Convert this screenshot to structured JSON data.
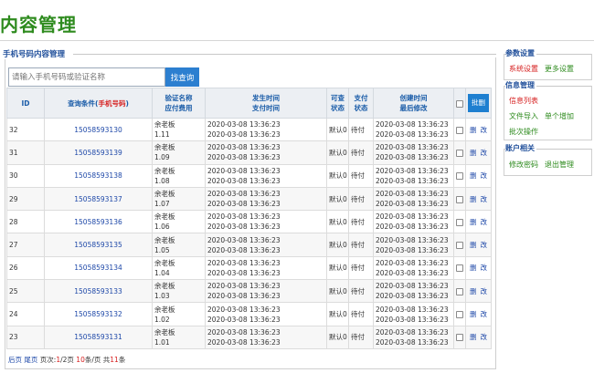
{
  "page_title": "内容管理",
  "panel_title": "手机号码内容管理",
  "search": {
    "placeholder": "请输入手机号码或验证名称",
    "button": "找查询"
  },
  "table": {
    "headers": {
      "id": "ID",
      "query_prefix": "查询条件(",
      "query_red": "手机号码",
      "query_suffix": ")",
      "name_line1": "验证名称",
      "name_line2": "应付费用",
      "time_line1": "发生时间",
      "time_line2": "支付时间",
      "status1_line1": "可查",
      "status1_line2": "状态",
      "status2_line1": "支付",
      "status2_line2": "状态",
      "created_line1": "创建时间",
      "created_line2": "最后修改",
      "batch_delete": "批删"
    },
    "rows": [
      {
        "id": "32",
        "phone": "15058593130",
        "name": "余老板",
        "fee": "1.11",
        "t1": "2020-03-08 13:36:23",
        "t2": "2020-03-08 13:36:23",
        "s1": "默认0",
        "s2": "待付",
        "c1": "2020-03-08 13:36:23",
        "c2": "2020-03-08 13:36:23",
        "del": "删",
        "edit": "改"
      },
      {
        "id": "31",
        "phone": "15058593139",
        "name": "余老板",
        "fee": "1.09",
        "t1": "2020-03-08 13:36:23",
        "t2": "2020-03-08 13:36:23",
        "s1": "默认0",
        "s2": "待付",
        "c1": "2020-03-08 13:36:23",
        "c2": "2020-03-08 13:36:23",
        "del": "删",
        "edit": "改"
      },
      {
        "id": "30",
        "phone": "15058593138",
        "name": "余老板",
        "fee": "1.08",
        "t1": "2020-03-08 13:36:23",
        "t2": "2020-03-08 13:36:23",
        "s1": "默认0",
        "s2": "待付",
        "c1": "2020-03-08 13:36:23",
        "c2": "2020-03-08 13:36:23",
        "del": "删",
        "edit": "改"
      },
      {
        "id": "29",
        "phone": "15058593137",
        "name": "余老板",
        "fee": "1.07",
        "t1": "2020-03-08 13:36:23",
        "t2": "2020-03-08 13:36:23",
        "s1": "默认0",
        "s2": "待付",
        "c1": "2020-03-08 13:36:23",
        "c2": "2020-03-08 13:36:23",
        "del": "删",
        "edit": "改"
      },
      {
        "id": "28",
        "phone": "15058593136",
        "name": "余老板",
        "fee": "1.06",
        "t1": "2020-03-08 13:36:23",
        "t2": "2020-03-08 13:36:23",
        "s1": "默认0",
        "s2": "待付",
        "c1": "2020-03-08 13:36:23",
        "c2": "2020-03-08 13:36:23",
        "del": "删",
        "edit": "改"
      },
      {
        "id": "27",
        "phone": "15058593135",
        "name": "余老板",
        "fee": "1.05",
        "t1": "2020-03-08 13:36:23",
        "t2": "2020-03-08 13:36:23",
        "s1": "默认0",
        "s2": "待付",
        "c1": "2020-03-08 13:36:23",
        "c2": "2020-03-08 13:36:23",
        "del": "删",
        "edit": "改"
      },
      {
        "id": "26",
        "phone": "15058593134",
        "name": "余老板",
        "fee": "1.04",
        "t1": "2020-03-08 13:36:23",
        "t2": "2020-03-08 13:36:23",
        "s1": "默认0",
        "s2": "待付",
        "c1": "2020-03-08 13:36:23",
        "c2": "2020-03-08 13:36:23",
        "del": "删",
        "edit": "改"
      },
      {
        "id": "25",
        "phone": "15058593133",
        "name": "余老板",
        "fee": "1.03",
        "t1": "2020-03-08 13:36:23",
        "t2": "2020-03-08 13:36:23",
        "s1": "默认0",
        "s2": "待付",
        "c1": "2020-03-08 13:36:23",
        "c2": "2020-03-08 13:36:23",
        "del": "删",
        "edit": "改"
      },
      {
        "id": "24",
        "phone": "15058593132",
        "name": "余老板",
        "fee": "1.02",
        "t1": "2020-03-08 13:36:23",
        "t2": "2020-03-08 13:36:23",
        "s1": "默认0",
        "s2": "待付",
        "c1": "2020-03-08 13:36:23",
        "c2": "2020-03-08 13:36:23",
        "del": "删",
        "edit": "改"
      },
      {
        "id": "23",
        "phone": "15058593131",
        "name": "余老板",
        "fee": "1.01",
        "t1": "2020-03-08 13:36:23",
        "t2": "2020-03-08 13:36:23",
        "s1": "默认0",
        "s2": "待付",
        "c1": "2020-03-08 13:36:23",
        "c2": "2020-03-08 13:36:23",
        "del": "删",
        "edit": "改"
      }
    ]
  },
  "pager": {
    "prev": "后页",
    "last": "尾页",
    "pages_label": "页次:",
    "current_page": "1",
    "total_pages": "2",
    "page_unit": "页",
    "per_page": "10",
    "per_page_unit": "条/页",
    "total_label": "共",
    "total_count": "11",
    "total_unit": "条"
  },
  "sidebar": {
    "sections": [
      {
        "title": "参数设置",
        "links": [
          {
            "label": "系统设置",
            "color": "#d62020"
          },
          {
            "label": "更多设置",
            "color": "#2e8b1e"
          }
        ]
      },
      {
        "title": "信息管理",
        "links": [
          {
            "label": "信息列表",
            "color": "#d62020"
          },
          {
            "label": "文件导入",
            "color": "#2e8b1e"
          },
          {
            "label": "单个增加",
            "color": "#2e8b1e"
          },
          {
            "label": "批次操作",
            "color": "#2e8b1e"
          }
        ]
      },
      {
        "title": "账户相关",
        "links": [
          {
            "label": "修改密码",
            "color": "#2e8b1e"
          },
          {
            "label": "退出管理",
            "color": "#2e8b1e"
          }
        ]
      }
    ]
  },
  "colors": {
    "title_green": "#2e8b1e",
    "link_blue": "#1e48a8",
    "accent_red": "#d62020",
    "button_blue": "#1e7fd0"
  }
}
